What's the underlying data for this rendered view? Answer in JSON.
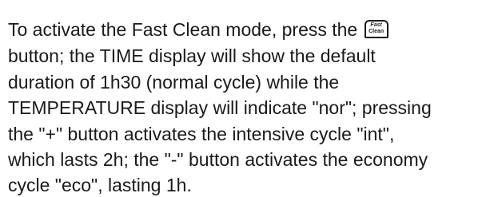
{
  "paragraph": {
    "lines": [
      "To activate the Fast Clean mode, press the",
      "button; the TIME display will show the default",
      "duration of 1h30 (normal cycle) while the",
      "TEMPERATURE display will indicate \"nor\"; pressing",
      "the \"+\" button activates the intensive cycle \"int\",",
      "which lasts 2h; the \"-\" button activates the economy",
      "cycle \"eco\", lasting 1h."
    ],
    "button_icon": {
      "icon": "fast-clean-button-icon",
      "line1": "Fast",
      "line2": "Clean"
    }
  }
}
